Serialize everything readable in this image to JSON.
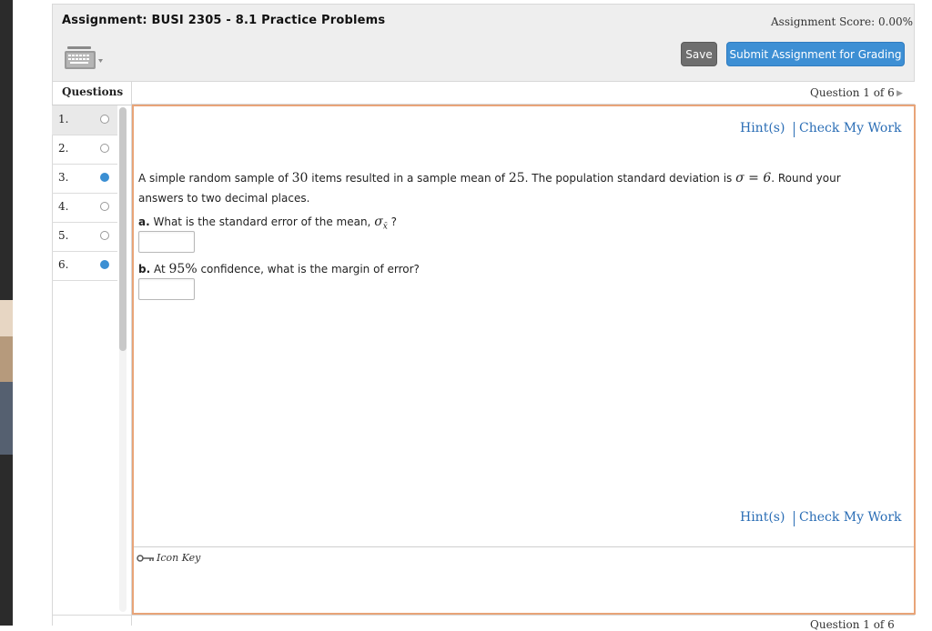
{
  "header": {
    "title": "Assignment: BUSI 2305 - 8.1 Practice Problems",
    "score": "Assignment Score: 0.00%",
    "save_label": "Save",
    "submit_label": "Submit Assignment for Grading"
  },
  "questions_panel": {
    "heading": "Questions",
    "items": [
      {
        "number": "1.",
        "answered": false,
        "active": true
      },
      {
        "number": "2.",
        "answered": false,
        "active": false
      },
      {
        "number": "3.",
        "answered": true,
        "active": false
      },
      {
        "number": "4.",
        "answered": false,
        "active": false
      },
      {
        "number": "5.",
        "answered": false,
        "active": false
      },
      {
        "number": "6.",
        "answered": true,
        "active": false
      }
    ]
  },
  "question_nav": {
    "label": "Question 1 of 6",
    "bottom_label": "Question 1 of 6"
  },
  "question": {
    "hints_label": "Hint(s)",
    "check_label": "Check My Work",
    "text_before_n": "A simple random sample of ",
    "n": "30",
    "text_mid1": " items resulted in a sample mean of ",
    "mean": "25",
    "text_mid2": ". The population standard deviation is ",
    "sigma": "σ = 6",
    "text_after": ". Round your answers to two decimal places.",
    "part_a_label": "a.",
    "part_a_text": " What is the standard error of the mean, ",
    "part_a_symbol": "σ",
    "part_a_sub": "x̄",
    "part_a_end": " ?",
    "part_a_value": "",
    "part_b_label": "b.",
    "part_b_text_before": " At ",
    "part_b_conf": "95%",
    "part_b_text_after": " confidence, what is the margin of error?",
    "part_b_value": ""
  },
  "icon_key_label": "Icon Key",
  "colors": {
    "accent_blue": "#3d8fd4",
    "content_border": "#e8a478",
    "link": "#2a6db5"
  }
}
